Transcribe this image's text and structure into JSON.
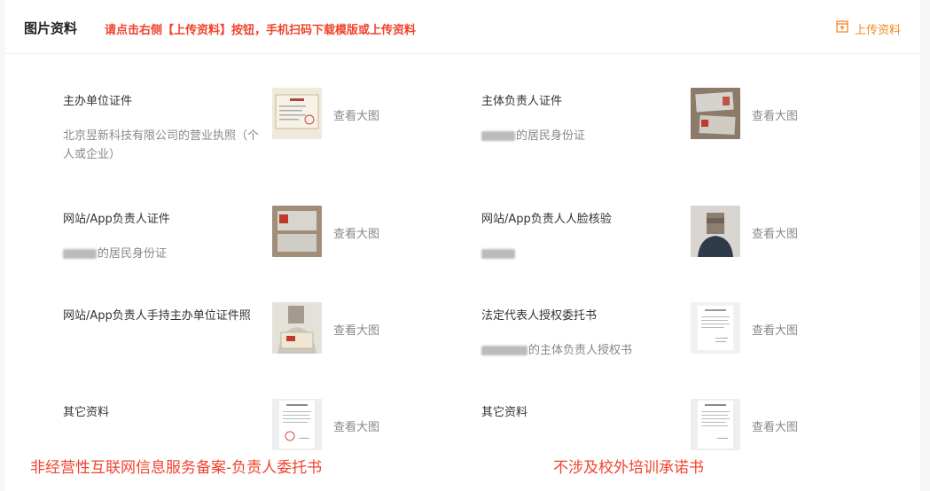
{
  "header": {
    "title": "图片资料",
    "tip": "请点击右侧【上传资料】按钮，手机扫码下载模版或上传资料",
    "upload_label": "上传资料"
  },
  "view_label": "查看大图",
  "items": [
    {
      "name": "主办单位证件",
      "desc": "北京昱新科技有限公司的营业执照（个人或企业）"
    },
    {
      "name": "主体负责人证件",
      "desc": "的居民身份证"
    },
    {
      "name": "网站/App负责人证件",
      "desc": "的居民身份证"
    },
    {
      "name": "网站/App负责人人脸核验",
      "desc": ""
    },
    {
      "name": "网站/App负责人手持主办单位证件照",
      "desc": ""
    },
    {
      "name": "法定代表人授权委托书",
      "desc": "的主体负责人授权书"
    },
    {
      "name": "其它资料",
      "desc": ""
    },
    {
      "name": "其它资料",
      "desc": ""
    }
  ],
  "bottom_left": "非经营性互联网信息服务备案-负责人委托书",
  "bottom_right": "不涉及校外培训承诺书",
  "colors": {
    "accent_red": "#f0432d",
    "accent_orange": "#f28a2a"
  },
  "icons": {
    "upload": "upload-doc-icon"
  }
}
